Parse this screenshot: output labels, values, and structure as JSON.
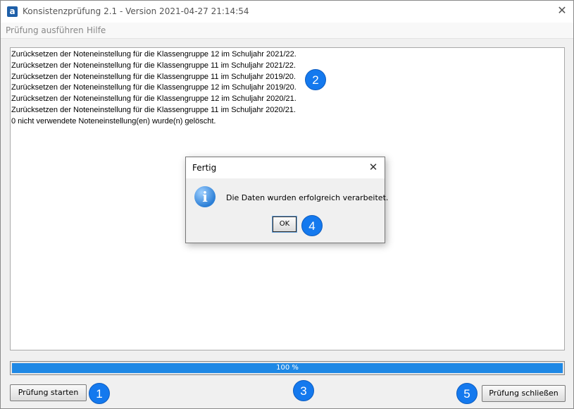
{
  "window": {
    "title": "Konsistenzprüfung 2.1 - Version 2021-04-27 21:14:54",
    "app_icon": "a",
    "close_icon": "✕"
  },
  "menu": {
    "items": [
      {
        "label": "Prüfung ausführen"
      },
      {
        "label": "Hilfe"
      }
    ]
  },
  "log": {
    "lines": [
      "Zurücksetzen der Noteneinstellung für die Klassengruppe 12 im Schuljahr 2021/22.",
      "Zurücksetzen der Noteneinstellung für die Klassengruppe 11 im Schuljahr 2021/22.",
      "Zurücksetzen der Noteneinstellung für die Klassengruppe 11 im Schuljahr 2019/20.",
      "Zurücksetzen der Noteneinstellung für die Klassengruppe 12 im Schuljahr 2019/20.",
      "Zurücksetzen der Noteneinstellung für die Klassengruppe 12 im Schuljahr 2020/21.",
      "Zurücksetzen der Noteneinstellung für die Klassengruppe 11 im Schuljahr 2020/21.",
      "0 nicht verwendete Noteneinstellung(en) wurde(n) gelöscht."
    ]
  },
  "progress": {
    "percent": 100,
    "text": "100 %",
    "color": "#1e88e5"
  },
  "buttons": {
    "start": "Prüfung starten",
    "close": "Prüfung schließen"
  },
  "dialog": {
    "title": "Fertig",
    "close_icon": "✕",
    "info_icon": "i",
    "message": "Die Daten wurden erfolgreich verarbeitet.",
    "ok": "OK"
  },
  "badges": {
    "b1": "1",
    "b2": "2",
    "b3": "3",
    "b4": "4",
    "b5": "5",
    "color": "#1479ee"
  }
}
